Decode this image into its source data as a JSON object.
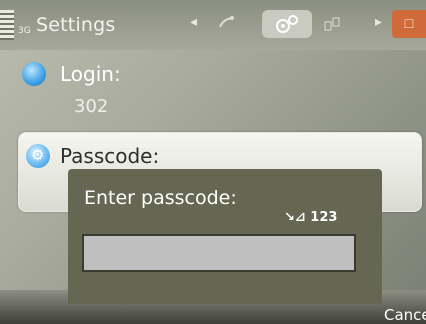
{
  "status": {
    "small_label": "3G"
  },
  "header": {
    "title": "Settings",
    "left_arrow": "◂",
    "right_arrow": "▸",
    "orange_tab_glyph": "☐"
  },
  "icons": {
    "tab1": "phone-tab-icon",
    "tab2": "settings-gear-tab-icon",
    "tab3": "network-tab-icon"
  },
  "list": {
    "login": {
      "label": "Login:",
      "value": "302"
    },
    "passcode": {
      "label": "Passcode:"
    }
  },
  "dialog": {
    "prompt": "Enter passcode:",
    "input_mode": "↘⊿ 123",
    "value": ""
  },
  "softkeys": {
    "right": "Cancel"
  }
}
